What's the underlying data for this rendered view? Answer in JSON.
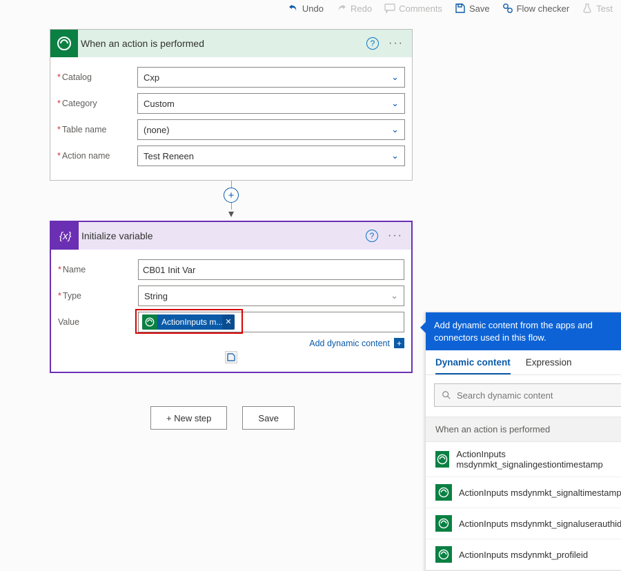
{
  "toolbar": {
    "undo": "Undo",
    "redo": "Redo",
    "comments": "Comments",
    "save": "Save",
    "flow_checker": "Flow checker",
    "test": "Test"
  },
  "trigger": {
    "title": "When an action is performed",
    "fields": {
      "catalog": {
        "label": "Catalog",
        "value": "Cxp"
      },
      "category": {
        "label": "Category",
        "value": "Custom"
      },
      "table": {
        "label": "Table name",
        "value": "(none)"
      },
      "action": {
        "label": "Action name",
        "value": "Test Reneen"
      }
    }
  },
  "init_var": {
    "title": "Initialize variable",
    "name_label": "Name",
    "name_value": "CB01 Init Var",
    "type_label": "Type",
    "type_value": "String",
    "value_label": "Value",
    "token_text": "ActionInputs m...",
    "add_dc": "Add dynamic content"
  },
  "bottom": {
    "new_step": "+ New step",
    "save": "Save"
  },
  "dc_panel": {
    "hint": "Add dynamic content from the apps and connectors used in this flow.",
    "tab_dynamic": "Dynamic content",
    "tab_expression": "Expression",
    "search_placeholder": "Search dynamic content",
    "group": "When an action is performed",
    "items": [
      "ActionInputs msdynmkt_signalingestiontimestamp",
      "ActionInputs msdynmkt_signaltimestamp",
      "ActionInputs msdynmkt_signaluserauthid",
      "ActionInputs msdynmkt_profileid"
    ]
  }
}
